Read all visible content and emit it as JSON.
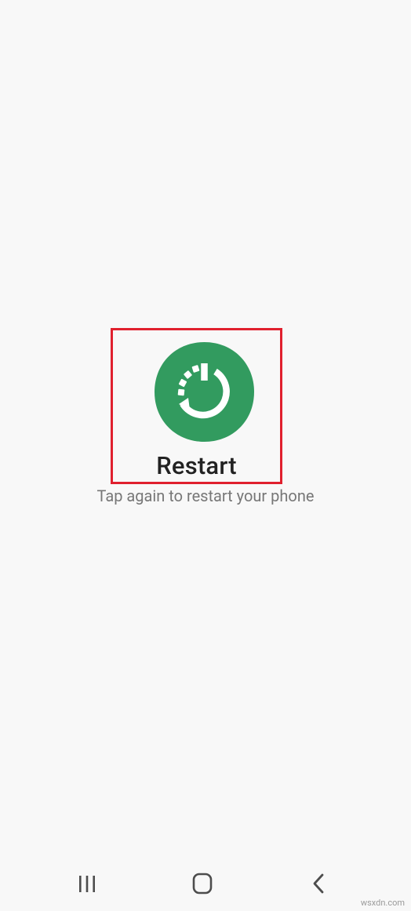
{
  "restart": {
    "label": "Restart",
    "hint": "Tap again to restart your phone",
    "icon": "restart-icon",
    "icon_color": "#329b5f",
    "highlight_color": "#e0202e"
  },
  "navigation": {
    "recents_icon": "recents-icon",
    "home_icon": "home-icon",
    "back_icon": "back-icon"
  },
  "watermark": "wsxdn.com"
}
